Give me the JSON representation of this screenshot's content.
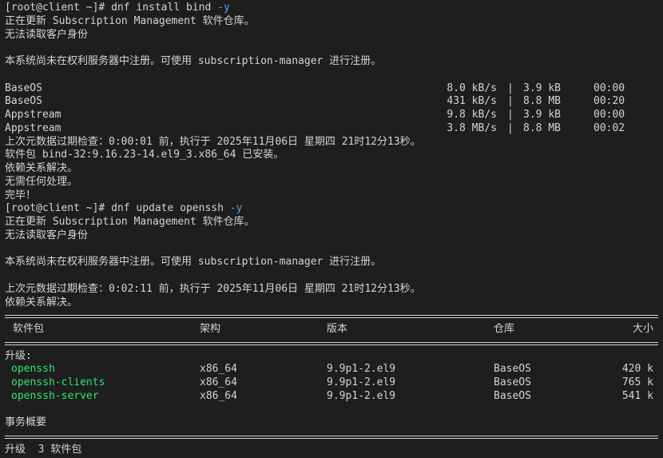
{
  "terminal": {
    "cmd1": {
      "prompt": "[root@client ~]# ",
      "command": "dnf install bind ",
      "flag": "-y"
    },
    "l_updating_sub": "正在更新 Subscription Management 软件仓库。",
    "l_cannot_read": "无法读取客户身份",
    "l_not_registered": "本系统尚未在权利服务器中注册。可使用 subscription-manager 进行注册。",
    "repos": [
      {
        "name": "BaseOS",
        "speed": "8.0 kB/s",
        "size": "3.9 kB",
        "time": "00:00"
      },
      {
        "name": "BaseOS",
        "speed": "431 kB/s",
        "size": "8.8 MB",
        "time": "00:20"
      },
      {
        "name": "Appstream",
        "speed": "9.8 kB/s",
        "size": "3.9 kB",
        "time": "00:00"
      },
      {
        "name": "Appstream",
        "speed": "3.8 MB/s",
        "size": "8.8 MB",
        "time": "00:02"
      }
    ],
    "l_meta_check1": "上次元数据过期检查：0:00:01 前，执行于 2025年11月06日 星期四 21时12分13秒。",
    "l_installed": "软件包 bind-32:9.16.23-14.el9_3.x86_64 已安装。",
    "l_deps_resolved": "依赖关系解决。",
    "l_nothing": "无需任何处理。",
    "l_done": "完毕！",
    "cmd2": {
      "prompt": "[root@client ~]# ",
      "command": "dnf update openssh ",
      "flag": "-y"
    },
    "l_meta_check2": "上次元数据过期检查：0:02:11 前，执行于 2025年11月06日 星期四 21时12分13秒。",
    "table": {
      "headers": {
        "package": "软件包",
        "arch": "架构",
        "version": "版本",
        "repo": "仓库",
        "size": "大小"
      },
      "section": "升级:",
      "rows": [
        {
          "package": "openssh",
          "arch": "x86_64",
          "version": "9.9p1-2.el9",
          "repo": "BaseOS",
          "size": "420 k"
        },
        {
          "package": "openssh-clients",
          "arch": "x86_64",
          "version": "9.9p1-2.el9",
          "repo": "BaseOS",
          "size": "765 k"
        },
        {
          "package": "openssh-server",
          "arch": "x86_64",
          "version": "9.9p1-2.el9",
          "repo": "BaseOS",
          "size": "541 k"
        }
      ],
      "summary_title": "事务概要",
      "summary_line": "升级  3 软件包"
    },
    "colors": {
      "background": "#1e1e1e",
      "text": "#d4d4d4",
      "flag": "#4aa3ff",
      "package": "#2ee66f"
    }
  }
}
